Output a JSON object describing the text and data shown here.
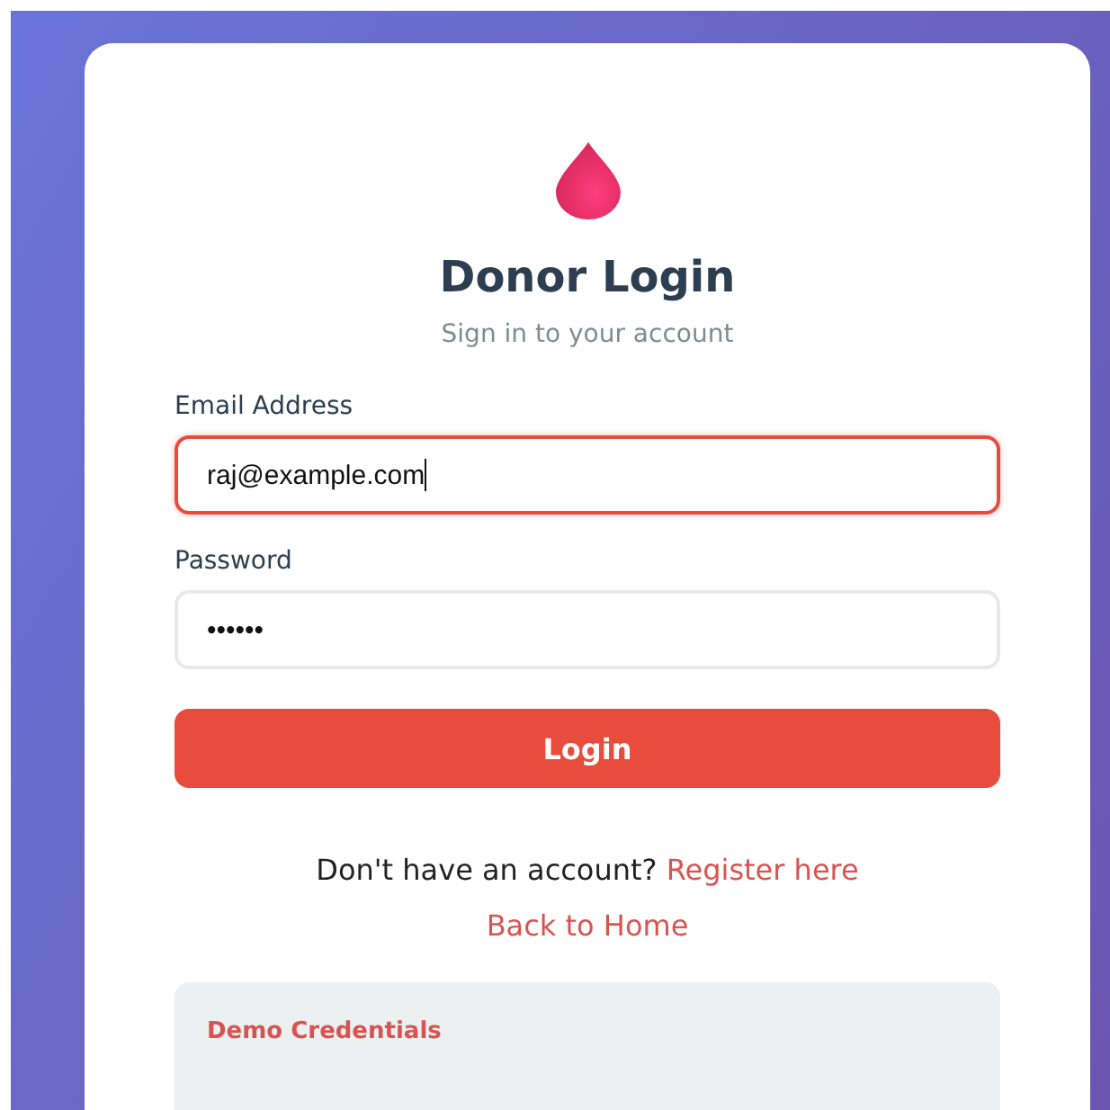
{
  "header": {
    "title": "Donor Login",
    "subtitle": "Sign in to your account"
  },
  "fields": [
    {
      "label": "Email Address",
      "value": "raj@example.com",
      "focused": true
    },
    {
      "label": "Password",
      "value": "••••••",
      "focused": false
    }
  ],
  "login_button": "Login",
  "register": {
    "prompt": "Don't have an account?",
    "link": "Register here"
  },
  "back_link": "Back to Home",
  "demo": {
    "title": "Demo Credentials"
  }
}
